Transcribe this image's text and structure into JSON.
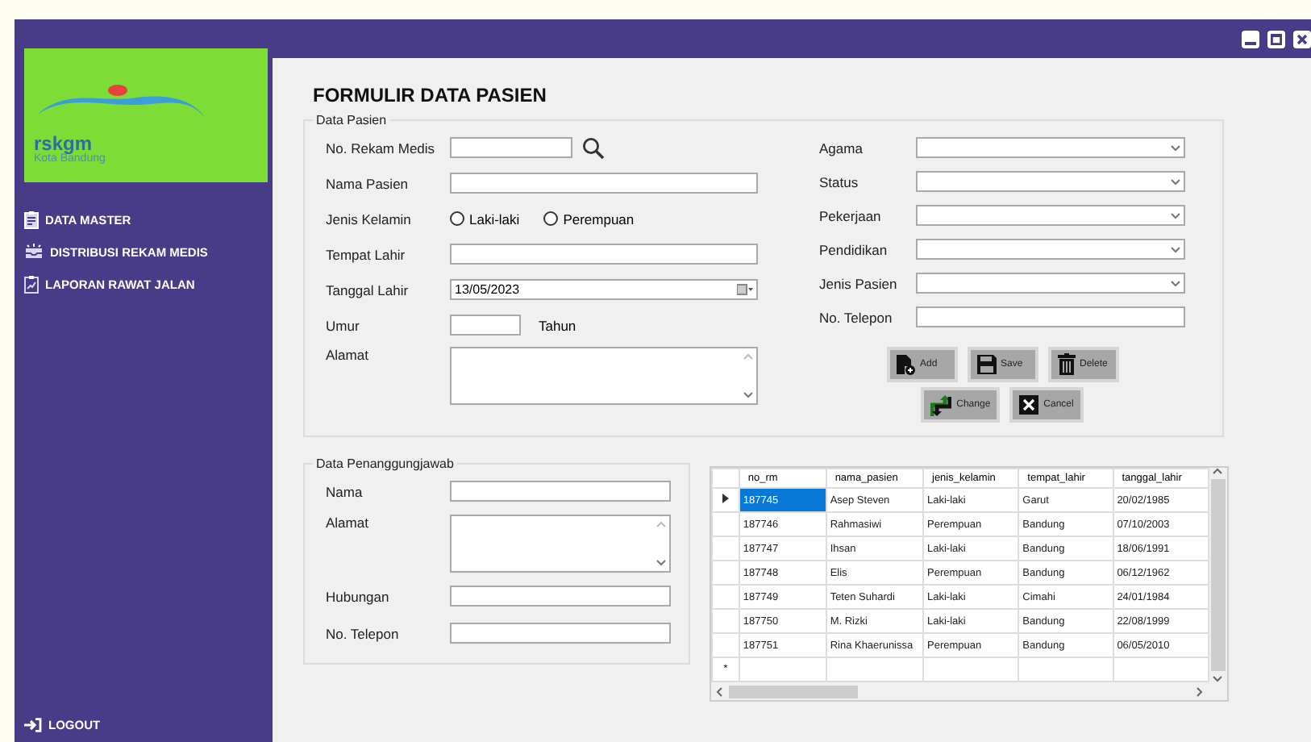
{
  "logo": {
    "name": "rskgm",
    "subtitle": "Kota Bandung"
  },
  "sidebar": {
    "items": [
      {
        "label": "DATA MASTER",
        "kind": "clipboard"
      },
      {
        "label": "DISTRIBUSI REKAM MEDIS",
        "kind": "inbox"
      },
      {
        "label": "LAPORAN RAWAT JALAN",
        "kind": "report"
      }
    ],
    "logout": "LOGOUT"
  },
  "form": {
    "title": "FORMULIR DATA PASIEN",
    "patient": {
      "legend": "Data Pasien",
      "left_fields": [
        {
          "kind": "search",
          "label": "No. Rekam Medis"
        },
        {
          "kind": "text",
          "label": "Nama Pasien"
        },
        {
          "kind": "radio",
          "label": "Jenis Kelamin",
          "options": [
            {
              "label": "Laki-laki",
              "selected": false
            },
            {
              "label": "Perempuan",
              "selected": false
            }
          ]
        },
        {
          "kind": "text",
          "label": "Tempat Lahir"
        },
        {
          "kind": "date",
          "label": "Tanggal Lahir",
          "value": "13/05/2023"
        },
        {
          "kind": "short",
          "label": "Umur",
          "suffix": "Tahun"
        },
        {
          "kind": "textarea",
          "label": "Alamat"
        }
      ],
      "right_fields": [
        {
          "kind": "combo",
          "label": "Agama"
        },
        {
          "kind": "combo",
          "label": "Status"
        },
        {
          "kind": "combo",
          "label": "Pekerjaan"
        },
        {
          "kind": "combo",
          "label": "Pendidikan"
        },
        {
          "kind": "combo",
          "label": "Jenis Pasien"
        },
        {
          "kind": "text",
          "label": "No. Telepon"
        }
      ],
      "button_rows": [
        [
          {
            "label": "Add",
            "kind": "add"
          },
          {
            "label": "Save",
            "kind": "save"
          },
          {
            "label": "Delete",
            "kind": "delete"
          }
        ],
        [
          {
            "label": "Change",
            "kind": "change"
          },
          {
            "label": "Cancel",
            "kind": "cancel"
          }
        ]
      ]
    },
    "guardian": {
      "legend": "Data Penanggungjawab",
      "fields": [
        {
          "kind": "text",
          "label": "Nama"
        },
        {
          "kind": "textarea",
          "label": "Alamat"
        },
        {
          "kind": "text",
          "label": "Hubungan"
        },
        {
          "kind": "text",
          "label": "No. Telepon"
        }
      ]
    }
  },
  "table": {
    "columns": [
      "no_rm",
      "nama_pasien",
      "jenis_kelamin",
      "tempat_lahir",
      "tanggal_lahir"
    ],
    "rows": [
      {
        "selected": true,
        "cells": [
          "187745",
          "Asep Steven",
          "Laki-laki",
          "Garut",
          "20/02/1985"
        ]
      },
      {
        "selected": false,
        "cells": [
          "187746",
          "Rahmasiwi",
          "Perempuan",
          "Bandung",
          "07/10/2003"
        ]
      },
      {
        "selected": false,
        "cells": [
          "187747",
          "Ihsan",
          "Laki-laki",
          "Bandung",
          "18/06/1991"
        ]
      },
      {
        "selected": false,
        "cells": [
          "187748",
          "Elis",
          "Perempuan",
          "Bandung",
          "06/12/1962"
        ]
      },
      {
        "selected": false,
        "cells": [
          "187749",
          "Teten Suhardi",
          "Laki-laki",
          "Cimahi",
          "24/01/1984"
        ]
      },
      {
        "selected": false,
        "cells": [
          "187750",
          "M. Rizki",
          "Laki-laki",
          "Bandung",
          "22/08/1999"
        ]
      },
      {
        "selected": false,
        "cells": [
          "187751",
          "Rina Khaerunissa",
          "Perempuan",
          "Bandung",
          "06/05/2010"
        ]
      }
    ],
    "new_row_marker": "*"
  }
}
